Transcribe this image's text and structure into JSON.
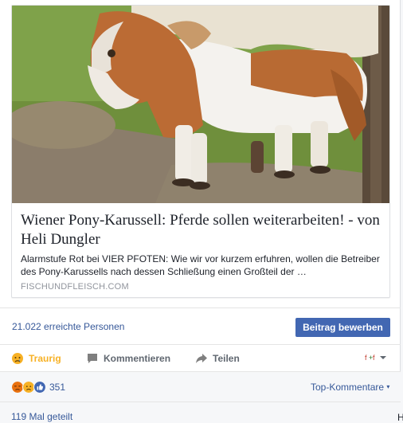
{
  "link_card": {
    "title": "Wiener Pony-Karussell: Pferde sollen weiterarbeiten! - von Heli Dungler",
    "description": "Alarmstufe Rot bei VIER PFOTEN: Wie wir vor kurzem erfuhren, wollen die Betreiber des Pony-Karussells nach dessen Schließung einen Großteil der …",
    "domain": "FISCHUNDFLEISCH.COM",
    "image_icon": "pony-photo"
  },
  "insights": {
    "reach": "21.022 erreichte Personen",
    "boost_label": "Beitrag bewerben"
  },
  "actions": {
    "sad_label": "Traurig",
    "comment_label": "Kommentieren",
    "share_label": "Teilen",
    "sad_color": "#f7b125"
  },
  "reactions": {
    "icons": [
      "angry-icon",
      "sad-icon",
      "like-icon"
    ],
    "count": "351",
    "top_comments_label": "Top-Kommentare",
    "shares": "119 Mal geteilt"
  },
  "corner_text": "H",
  "colors": {
    "link": "#365899",
    "button": "#4267b2"
  }
}
